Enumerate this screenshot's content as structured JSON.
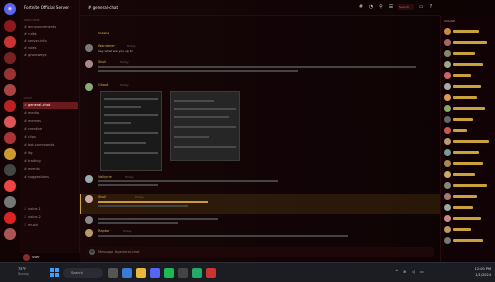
{
  "server": {
    "name": "Fortnite Official Server"
  },
  "header": {
    "channel": "# general-chat",
    "search_placeholder": "Search"
  },
  "categories": [
    "Welcome",
    "Chat"
  ],
  "channels": [
    {
      "label": "announcements"
    },
    {
      "label": "rules"
    },
    {
      "label": "server-info"
    },
    {
      "label": "roles"
    },
    {
      "label": "giveaways"
    },
    {
      "label": "general-chat"
    },
    {
      "label": "media"
    },
    {
      "label": "memes"
    },
    {
      "label": "creative"
    },
    {
      "label": "clips"
    },
    {
      "label": "bot-commands"
    },
    {
      "label": "lfg"
    },
    {
      "label": "trading"
    },
    {
      "label": "events"
    },
    {
      "label": "suggestions"
    },
    {
      "label": "voice-1"
    },
    {
      "label": "voice-2"
    },
    {
      "label": "music"
    }
  ],
  "user": {
    "name": "user"
  },
  "messages": [
    {
      "name": "",
      "time": "",
      "text": "hahaha"
    },
    {
      "name": "Wanderer",
      "time": "Today",
      "text": "hey what are you up to"
    },
    {
      "name": "Skull",
      "time": "Today",
      "text": ""
    },
    {
      "name": "Ghost",
      "time": "Today",
      "text": ""
    },
    {
      "name": "Valkyrie",
      "time": "Today",
      "text": ""
    },
    {
      "name": "Skull",
      "time": "Today",
      "text": ""
    },
    {
      "name": "Raptor",
      "time": "Today",
      "text": ""
    }
  ],
  "composer": {
    "placeholder": "Message #general-chat"
  },
  "members_header": "ONLINE",
  "taskbar": {
    "weather_temp": "75°F",
    "weather_desc": "Sunny",
    "search": "Search",
    "time": "12:00 PM",
    "date": "1/1/2024"
  },
  "colors": {
    "accent": "#8a1a1e",
    "username": "#c9b44a",
    "member_name": "#c9a23a"
  }
}
